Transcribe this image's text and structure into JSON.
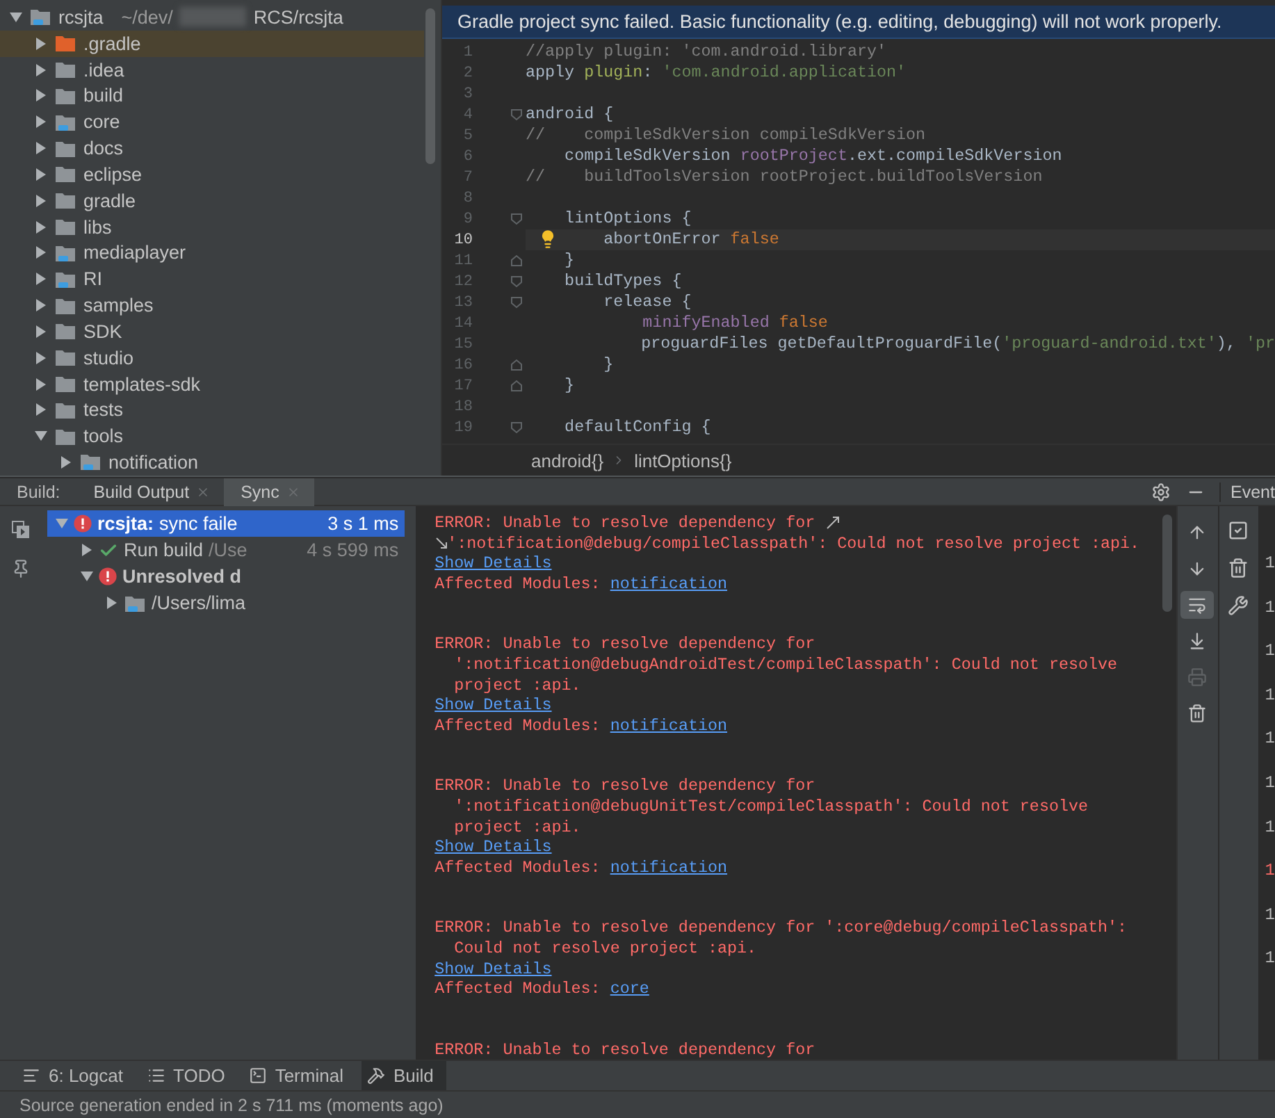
{
  "project": {
    "tree": [
      {
        "label": "rcsjta",
        "path": [
          "~/dev/",
          "RCS/rcsjta"
        ],
        "kind": "module",
        "expanded": true,
        "selected": false,
        "children": [
          {
            "label": ".gradle",
            "kind": "excluded",
            "expanded": false,
            "selected": true
          },
          {
            "label": ".idea",
            "kind": "folder",
            "expanded": false,
            "selected": false
          },
          {
            "label": "build",
            "kind": "folder",
            "expanded": false,
            "selected": false
          },
          {
            "label": "core",
            "kind": "module",
            "expanded": false,
            "selected": false
          },
          {
            "label": "docs",
            "kind": "folder",
            "expanded": false,
            "selected": false
          },
          {
            "label": "eclipse",
            "kind": "folder",
            "expanded": false,
            "selected": false
          },
          {
            "label": "gradle",
            "kind": "folder",
            "expanded": false,
            "selected": false
          },
          {
            "label": "libs",
            "kind": "folder",
            "expanded": false,
            "selected": false
          },
          {
            "label": "mediaplayer",
            "kind": "module",
            "expanded": false,
            "selected": false
          },
          {
            "label": "RI",
            "kind": "module",
            "expanded": false,
            "selected": false
          },
          {
            "label": "samples",
            "kind": "folder",
            "expanded": false,
            "selected": false
          },
          {
            "label": "SDK",
            "kind": "folder",
            "expanded": false,
            "selected": false
          },
          {
            "label": "studio",
            "kind": "folder",
            "expanded": false,
            "selected": false
          },
          {
            "label": "templates-sdk",
            "kind": "folder",
            "expanded": false,
            "selected": false
          },
          {
            "label": "tests",
            "kind": "folder",
            "expanded": false,
            "selected": false
          },
          {
            "label": "tools",
            "kind": "folder",
            "expanded": true,
            "selected": false,
            "children": [
              {
                "label": "notification",
                "kind": "module",
                "expanded": false,
                "selected": false
              }
            ]
          }
        ]
      }
    ]
  },
  "editor": {
    "banner": "Gradle project sync failed. Basic functionality (e.g. editing, debugging) will not work properly.",
    "lines": [
      {
        "n": "1",
        "fold_start": false,
        "fold_end": false,
        "current": false,
        "bulb": false,
        "tokens": [
          {
            "text": "//apply plugin: 'com.android.library'",
            "kind": "comment"
          }
        ]
      },
      {
        "n": "2",
        "fold_start": false,
        "fold_end": false,
        "current": false,
        "bulb": false,
        "tokens": [
          {
            "text": "apply ",
            "kind": "plain"
          },
          {
            "text": "plugin",
            "kind": "arg"
          },
          {
            "text": ": ",
            "kind": "plain"
          },
          {
            "text": "'com.android.application'",
            "kind": "string"
          }
        ]
      },
      {
        "n": "3",
        "fold_start": false,
        "fold_end": false,
        "current": false,
        "bulb": false
      },
      {
        "n": "4",
        "fold_start": true,
        "fold_end": false,
        "current": false,
        "bulb": false,
        "tokens": [
          {
            "text": "android {",
            "kind": "plain"
          }
        ]
      },
      {
        "n": "5",
        "fold_start": false,
        "fold_end": false,
        "current": false,
        "bulb": false,
        "tokens": [
          {
            "text": "//    compileSdkVersion compileSdkVersion",
            "kind": "comment"
          }
        ]
      },
      {
        "n": "6",
        "fold_start": false,
        "fold_end": false,
        "current": false,
        "bulb": false,
        "tokens": [
          {
            "text": "    compileSdkVersion ",
            "kind": "plain"
          },
          {
            "text": "rootProject",
            "kind": "property"
          },
          {
            "text": ".ext.compileSdkVersion",
            "kind": "plain"
          }
        ]
      },
      {
        "n": "7",
        "fold_start": false,
        "fold_end": false,
        "current": false,
        "bulb": false,
        "tokens": [
          {
            "text": "//    buildToolsVersion rootProject.buildToolsVersion",
            "kind": "comment"
          }
        ]
      },
      {
        "n": "8",
        "fold_start": false,
        "fold_end": false,
        "current": false,
        "bulb": false
      },
      {
        "n": "9",
        "fold_start": true,
        "fold_end": false,
        "current": false,
        "bulb": false,
        "tokens": [
          {
            "text": "    lintOptions {",
            "kind": "plain"
          }
        ]
      },
      {
        "n": "10",
        "fold_start": false,
        "fold_end": false,
        "current": true,
        "bulb": true,
        "tokens": [
          {
            "text": "        abortOnError ",
            "kind": "plain"
          },
          {
            "text": "false",
            "kind": "keyword"
          }
        ]
      },
      {
        "n": "11",
        "fold_start": false,
        "fold_end": true,
        "current": false,
        "bulb": false,
        "tokens": [
          {
            "text": "    }",
            "kind": "plain"
          }
        ]
      },
      {
        "n": "12",
        "fold_start": true,
        "fold_end": false,
        "current": false,
        "bulb": false,
        "tokens": [
          {
            "text": "    buildTypes {",
            "kind": "plain"
          }
        ]
      },
      {
        "n": "13",
        "fold_start": true,
        "fold_end": false,
        "current": false,
        "bulb": false,
        "tokens": [
          {
            "text": "        release {",
            "kind": "plain"
          }
        ]
      },
      {
        "n": "14",
        "fold_start": false,
        "fold_end": false,
        "current": false,
        "bulb": false,
        "tokens": [
          {
            "text": "            minifyEnabled ",
            "kind": "property"
          },
          {
            "text": "false",
            "kind": "keyword"
          }
        ]
      },
      {
        "n": "15",
        "fold_start": false,
        "fold_end": false,
        "current": false,
        "bulb": false,
        "tokens": [
          {
            "text": "            proguardFiles getDefaultProguardFile(",
            "kind": "plain"
          },
          {
            "text": "'proguard-android.txt'",
            "kind": "string"
          },
          {
            "text": "), ",
            "kind": "plain"
          },
          {
            "text": "'pr",
            "kind": "string"
          }
        ]
      },
      {
        "n": "16",
        "fold_start": false,
        "fold_end": true,
        "current": false,
        "bulb": false,
        "tokens": [
          {
            "text": "        }",
            "kind": "plain"
          }
        ]
      },
      {
        "n": "17",
        "fold_start": false,
        "fold_end": true,
        "current": false,
        "bulb": false,
        "tokens": [
          {
            "text": "    }",
            "kind": "plain"
          }
        ]
      },
      {
        "n": "18",
        "fold_start": false,
        "fold_end": false,
        "current": false,
        "bulb": false
      },
      {
        "n": "19",
        "fold_start": true,
        "fold_end": false,
        "current": false,
        "bulb": false,
        "tokens": [
          {
            "text": "    defaultConfig {",
            "kind": "plain"
          }
        ]
      }
    ],
    "breadcrumbs": [
      "android{}",
      "lintOptions{}"
    ]
  },
  "build": {
    "label": "Build:",
    "tabs": [
      {
        "label": "Build Output",
        "selected": false
      },
      {
        "label": "Sync",
        "selected": true
      }
    ],
    "side_tab": "Event",
    "tree": [
      {
        "label": "rcsjta:",
        "detail": "sync faile",
        "time": "3 s 1 ms",
        "kind": "error",
        "expanded": true,
        "selected": true,
        "children": [
          {
            "label": "Run build",
            "detail": "/Use",
            "time": "4 s 599 ms",
            "kind": "success",
            "expanded": false,
            "selected": false
          },
          {
            "label": "Unresolved d",
            "kind": "error",
            "expanded": true,
            "selected": false,
            "children": [
              {
                "label": "/Users/lima",
                "kind": "folder",
                "expanded": false,
                "selected": false
              }
            ]
          }
        ]
      }
    ],
    "output": [
      {
        "wrapped": true,
        "lines": [
          "ERROR: Unable to resolve dependency for",
          "':notification@debug/compileClasspath': Could not resolve project :api."
        ],
        "link": "Show Details",
        "affected_label": "Affected Modules:",
        "module": "notification"
      },
      {
        "wrapped": false,
        "lines": [
          "ERROR: Unable to resolve dependency for",
          "  ':notification@debugAndroidTest/compileClasspath': Could not resolve",
          "  project :api."
        ],
        "link": "Show Details",
        "affected_label": "Affected Modules:",
        "module": "notification"
      },
      {
        "wrapped": false,
        "lines": [
          "ERROR: Unable to resolve dependency for",
          "  ':notification@debugUnitTest/compileClasspath': Could not resolve",
          "  project :api."
        ],
        "link": "Show Details",
        "affected_label": "Affected Modules:",
        "module": "notification"
      },
      {
        "wrapped": false,
        "lines": [
          "ERROR: Unable to resolve dependency for ':core@debug/compileClasspath':",
          "  Could not resolve project :api."
        ],
        "link": "Show Details",
        "affected_label": "Affected Modules:",
        "module": "core"
      },
      {
        "wrapped": false,
        "lines": [
          "ERROR: Unable to resolve dependency for"
        ]
      }
    ],
    "toolbar": [
      {
        "kind": "up",
        "on": false,
        "disabled": false
      },
      {
        "kind": "down",
        "on": false,
        "disabled": false
      },
      {
        "kind": "wrap",
        "on": true,
        "disabled": false
      },
      {
        "kind": "scroll-end",
        "on": false,
        "disabled": false
      },
      {
        "kind": "print",
        "on": false,
        "disabled": true
      },
      {
        "kind": "trash",
        "on": false,
        "disabled": false
      }
    ],
    "events": [
      {
        "text": "1",
        "kind": "info"
      },
      {
        "text": "1",
        "kind": "info"
      },
      {
        "text": "1",
        "kind": "info"
      },
      {
        "text": "1",
        "kind": "info"
      },
      {
        "text": "1",
        "kind": "info"
      },
      {
        "text": "1",
        "kind": "info"
      },
      {
        "text": "1",
        "kind": "info"
      },
      {
        "text": "1",
        "kind": "error"
      },
      {
        "text": "1",
        "kind": "info"
      },
      {
        "text": "1",
        "kind": "info"
      }
    ]
  },
  "tool_tabs": [
    {
      "label": "6: Logcat",
      "kind": "logcat",
      "selected": false
    },
    {
      "label": "TODO",
      "kind": "todo",
      "selected": false
    },
    {
      "label": "Terminal",
      "kind": "terminal",
      "selected": false
    },
    {
      "label": "Build",
      "kind": "build",
      "selected": true
    }
  ],
  "status_bar": "Source generation ended in 2 s 711 ms (moments ago)"
}
